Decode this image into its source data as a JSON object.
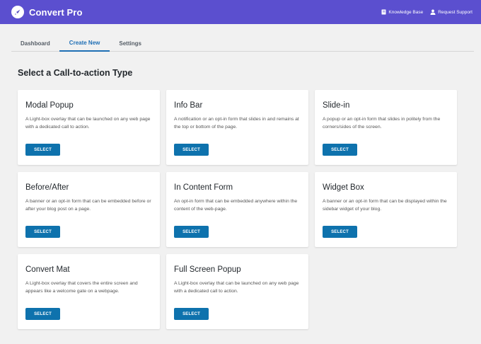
{
  "header": {
    "brand": "Convert Pro",
    "links": [
      {
        "label": "Knowledge Base",
        "icon": "book-icon"
      },
      {
        "label": "Request Support",
        "icon": "user-icon"
      }
    ]
  },
  "tabs": [
    {
      "label": "Dashboard",
      "active": false
    },
    {
      "label": "Create New",
      "active": true
    },
    {
      "label": "Settings",
      "active": false
    }
  ],
  "section_title": "Select a Call-to-action Type",
  "cards": [
    {
      "title": "Modal Popup",
      "description": "A Light-box overlay that can be launched on any web page with a dedicated call to action.",
      "button": "SELECT"
    },
    {
      "title": "Info Bar",
      "description": "A notification or an opt-in form that slides in and remains at the top or bottom of the page.",
      "button": "SELECT"
    },
    {
      "title": "Slide-in",
      "description": "A popup or an opt-in form that slides in politely from the corners/sides of the screen.",
      "button": "SELECT"
    },
    {
      "title": "Before/After",
      "description": "A banner or an opt-in form that can be embedded before or after your blog post on a page.",
      "button": "SELECT"
    },
    {
      "title": "In Content Form",
      "description": "An opt-in form that can be embedded anywhere within the content of the web-page.",
      "button": "SELECT"
    },
    {
      "title": "Widget Box",
      "description": "A banner or an opt-in form that can be displayed within the sidebar widget of your blog.",
      "button": "SELECT"
    },
    {
      "title": "Convert Mat",
      "description": "A Light-box overlay that covers the entire screen and appears like a welcome gate on a webpage.",
      "button": "SELECT"
    },
    {
      "title": "Full Screen Popup",
      "description": "A Light-box overlay that can be launched on any web page with a dedicated call to action.",
      "button": "SELECT"
    }
  ],
  "colors": {
    "header_bg": "#5b4fcf",
    "accent": "#1f6fb5",
    "button_bg": "#0e72ad",
    "page_bg": "#f1f1f1"
  }
}
